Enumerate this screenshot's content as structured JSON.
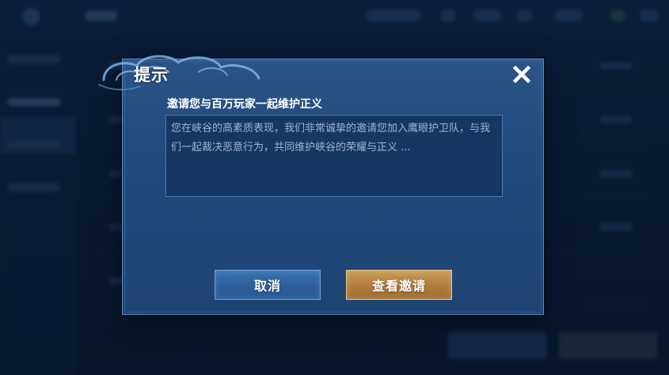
{
  "dialog": {
    "title": "提示",
    "close_icon": "close-icon",
    "heading": "邀请您与百万玩家一起维护正义",
    "message": "您在峡谷的高素质表现，我们非常诚挚的邀请您加入鹰眼护卫队，与我们一起裁决恶意行为，共同维护峡谷的荣耀与正义 ...",
    "buttons": {
      "cancel_label": "取消",
      "confirm_label": "查看邀请"
    }
  },
  "colors": {
    "panel": "#234a7c",
    "panel_border": "#5b8bc4",
    "message_bg": "#163762",
    "message_text": "#9db4d2",
    "cancel_button": "#2c5f9b",
    "confirm_button": "#b07d3d",
    "title_text": "#ffffff"
  }
}
